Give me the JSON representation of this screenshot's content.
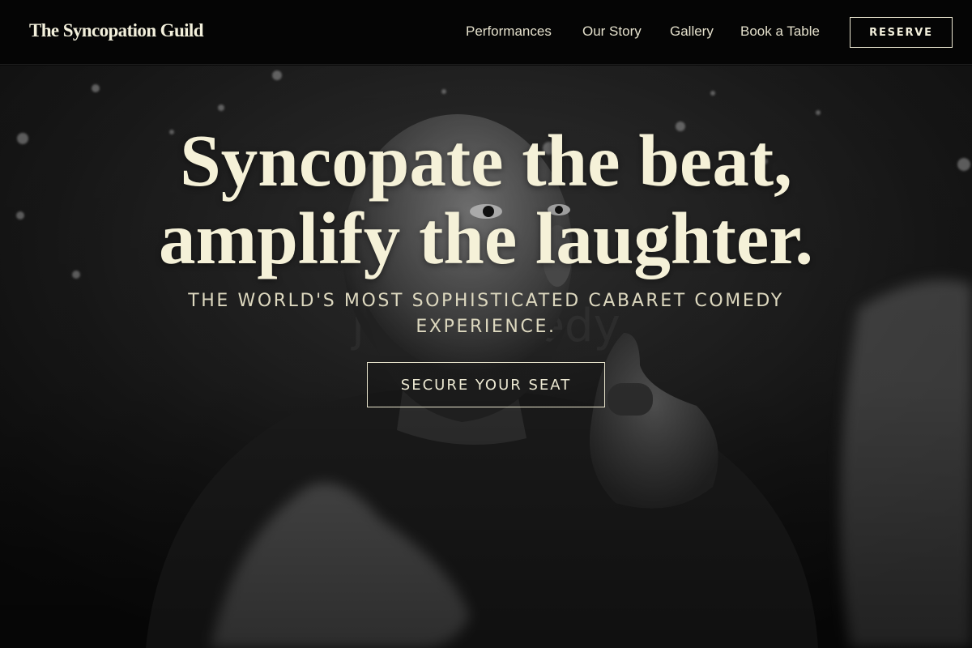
{
  "header": {
    "brand": "The Syncopation Guild",
    "nav": [
      "Performances",
      "Our Story",
      "Gallery",
      "Book a Table"
    ],
    "reserve_label": "RESERVE"
  },
  "hero": {
    "headline_line1": "Syncopate the beat,",
    "headline_line2": "amplify the laughter.",
    "subtitle": "THE WORLD'S MOST SOPHISTICATED CABARET COMEDY EXPERIENCE.",
    "cta_label": "SECURE YOUR SEAT",
    "background_photo": "black-and-white-comedian-pointing-at-camera"
  },
  "colors": {
    "header_bg": "#050505",
    "text_cream": "#f5f1d8",
    "nav_text": "#e4e0cc",
    "border_cream": "#ece8d2"
  }
}
